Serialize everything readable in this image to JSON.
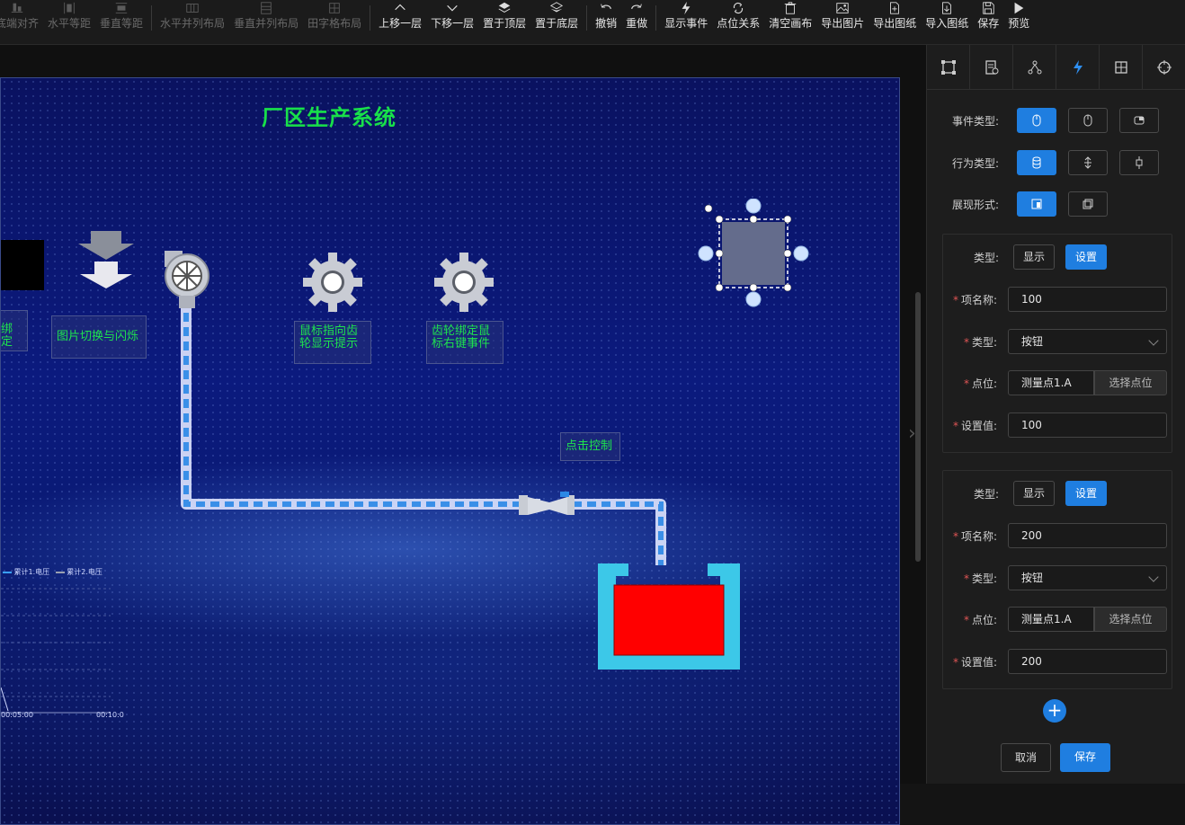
{
  "toolbar": {
    "items": [
      {
        "label": "底端对齐",
        "icon": "align-bottom-icon",
        "disabled": true
      },
      {
        "label": "水平等距",
        "icon": "horizontal-distribute-icon",
        "disabled": true
      },
      {
        "label": "垂直等距",
        "icon": "vertical-distribute-icon",
        "disabled": true
      },
      {
        "label": "水平并列布局",
        "icon": "horizontal-layout-icon",
        "disabled": true
      },
      {
        "label": "垂直并列布局",
        "icon": "vertical-layout-icon",
        "disabled": true
      },
      {
        "label": "田字格布局",
        "icon": "grid-layout-icon",
        "disabled": true
      },
      {
        "label": "上移一层",
        "icon": "chevron-up-icon",
        "disabled": false
      },
      {
        "label": "下移一层",
        "icon": "chevron-down-icon",
        "disabled": false
      },
      {
        "label": "置于顶层",
        "icon": "layers-top-icon",
        "disabled": false
      },
      {
        "label": "置于底层",
        "icon": "layers-bottom-icon",
        "disabled": false
      },
      {
        "label": "撤销",
        "icon": "undo-icon",
        "disabled": false
      },
      {
        "label": "重做",
        "icon": "redo-icon",
        "disabled": false
      },
      {
        "label": "显示事件",
        "icon": "lightning-icon",
        "disabled": false
      },
      {
        "label": "点位关系",
        "icon": "refresh-icon",
        "disabled": false
      },
      {
        "label": "清空画布",
        "icon": "trash-icon",
        "disabled": false
      },
      {
        "label": "导出图片",
        "icon": "image-icon",
        "disabled": false
      },
      {
        "label": "导出图纸",
        "icon": "export-file-icon",
        "disabled": false
      },
      {
        "label": "导入图纸",
        "icon": "import-file-icon",
        "disabled": false
      },
      {
        "label": "保存",
        "icon": "save-icon",
        "disabled": false
      },
      {
        "label": "预览",
        "icon": "play-icon",
        "disabled": false
      }
    ]
  },
  "canvas": {
    "title": "厂区生产系统",
    "labels": {
      "bind_partial": "绑定",
      "image_switch": "图片切换与闪烁",
      "gear_hover": "鼠标指向齿轮显示提示",
      "gear_right_click": "齿轮绑定鼠标右键事件",
      "click_control": "点击控制"
    },
    "chart": {
      "legend_1": "累计1.电压",
      "legend_2": "累计2.电压",
      "x_tick_1": "00:05:00",
      "x_tick_2": "00:10:0"
    }
  },
  "panel": {
    "tabs": [
      "resize-icon",
      "document-icon",
      "node-icon",
      "lightning-icon",
      "grid-icon",
      "crosshair-icon"
    ],
    "event_type_label": "事件类型:",
    "action_type_label": "行为类型:",
    "display_form_label": "展现形式:",
    "cards": [
      {
        "type_label": "类型:",
        "btn_show": "显示",
        "btn_set": "设置",
        "name_label": "项名称:",
        "name_value": "100",
        "kind_label": "类型:",
        "kind_value": "按钮",
        "point_label": "点位:",
        "point_value": "测量点1.A",
        "point_pick": "选择点位",
        "setvalue_label": "设置值:",
        "setvalue_value": "100"
      },
      {
        "type_label": "类型:",
        "btn_show": "显示",
        "btn_set": "设置",
        "name_label": "项名称:",
        "name_value": "200",
        "kind_label": "类型:",
        "kind_value": "按钮",
        "point_label": "点位:",
        "point_value": "测量点1.A",
        "point_pick": "选择点位",
        "setvalue_label": "设置值:",
        "setvalue_value": "200"
      }
    ],
    "add_label": "+",
    "cancel_label": "取消",
    "save_label": "保存"
  },
  "colors": {
    "accent": "#1f7ee0",
    "title_green": "#18e04a",
    "tank_red": "#ff0000",
    "tank_frame": "#3cc8e8"
  }
}
